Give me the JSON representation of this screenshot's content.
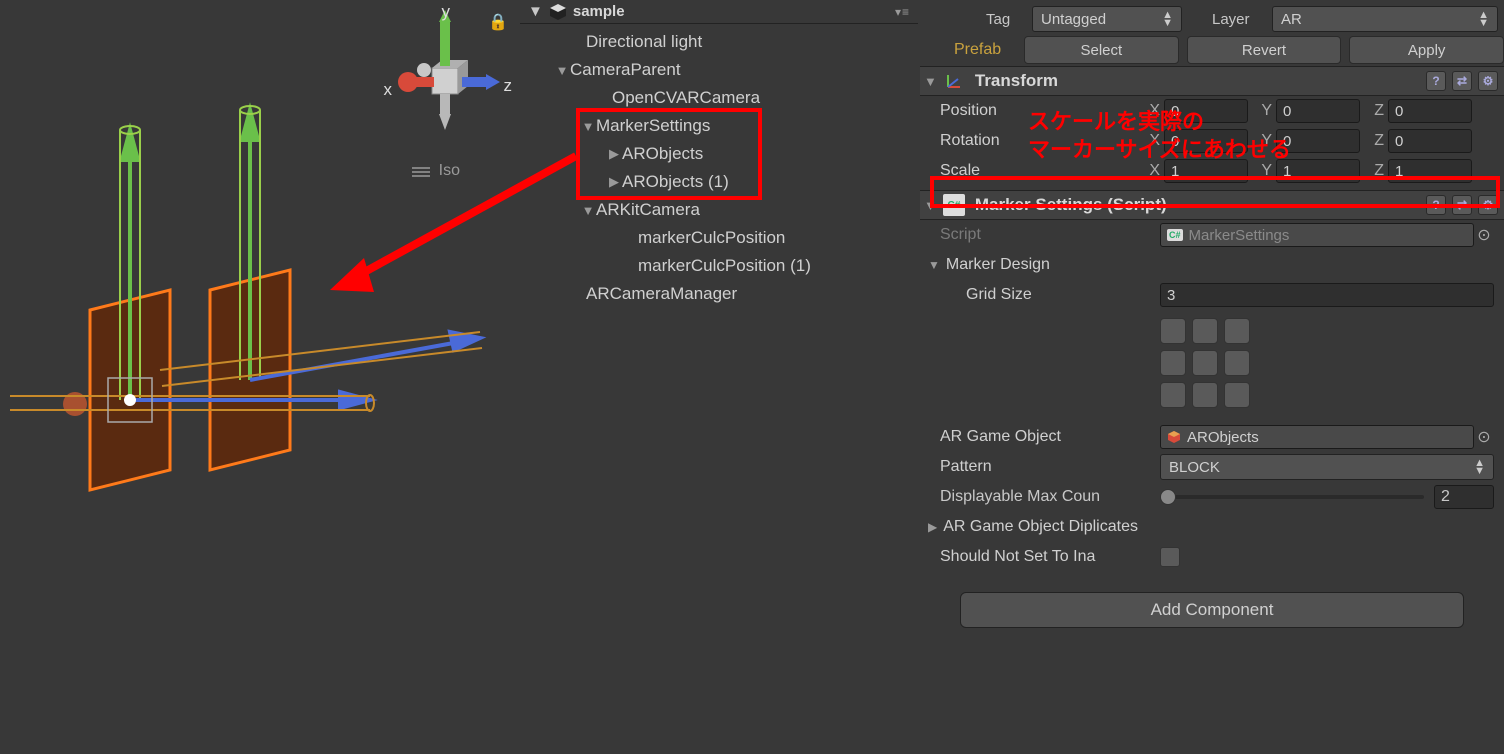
{
  "hierarchy": {
    "scene_name": "sample",
    "items": {
      "directional_light": "Directional light",
      "camera_parent": "CameraParent",
      "opencv_ar_camera": "OpenCVARCamera",
      "marker_settings": "MarkerSettings",
      "ar_objects": "ARObjects",
      "ar_objects_1": "ARObjects (1)",
      "arkit_camera": "ARKitCamera",
      "marker_culc_pos": "markerCulcPosition",
      "marker_culc_pos_1": "markerCulcPosition (1)",
      "ar_camera_manager": "ARCameraManager"
    }
  },
  "scene": {
    "projection": "Iso",
    "axes": {
      "x": "x",
      "y": "y",
      "z": "z"
    }
  },
  "inspector": {
    "tag_label": "Tag",
    "tag_value": "Untagged",
    "layer_label": "Layer",
    "layer_value": "AR",
    "prefab_label": "Prefab",
    "prefab_select": "Select",
    "prefab_revert": "Revert",
    "prefab_apply": "Apply",
    "transform": {
      "title": "Transform",
      "position_label": "Position",
      "rotation_label": "Rotation",
      "scale_label": "Scale",
      "pos": {
        "x": "0",
        "y": "0",
        "z": "0"
      },
      "rot": {
        "x": "0",
        "y": "0",
        "z": "0"
      },
      "scale": {
        "x": "1",
        "y": "1",
        "z": "1"
      }
    },
    "marker_settings": {
      "title": "Marker Settings (Script)",
      "script_label": "Script",
      "script_value": "MarkerSettings",
      "marker_design_label": "Marker Design",
      "grid_size_label": "Grid Size",
      "grid_size_value": "3",
      "ar_game_object_label": "AR Game Object",
      "ar_game_object_value": "ARObjects",
      "pattern_label": "Pattern",
      "pattern_value": "BLOCK",
      "displayable_label": "Displayable Max Coun",
      "displayable_value": "2",
      "ar_dup_label": "AR Game Object Diplicates",
      "should_not_label": "Should Not Set To Ina"
    },
    "add_component": "Add Component"
  },
  "annotations": {
    "line1": "スケールを実際の",
    "line2": "マーカーサイズにあわせる"
  }
}
